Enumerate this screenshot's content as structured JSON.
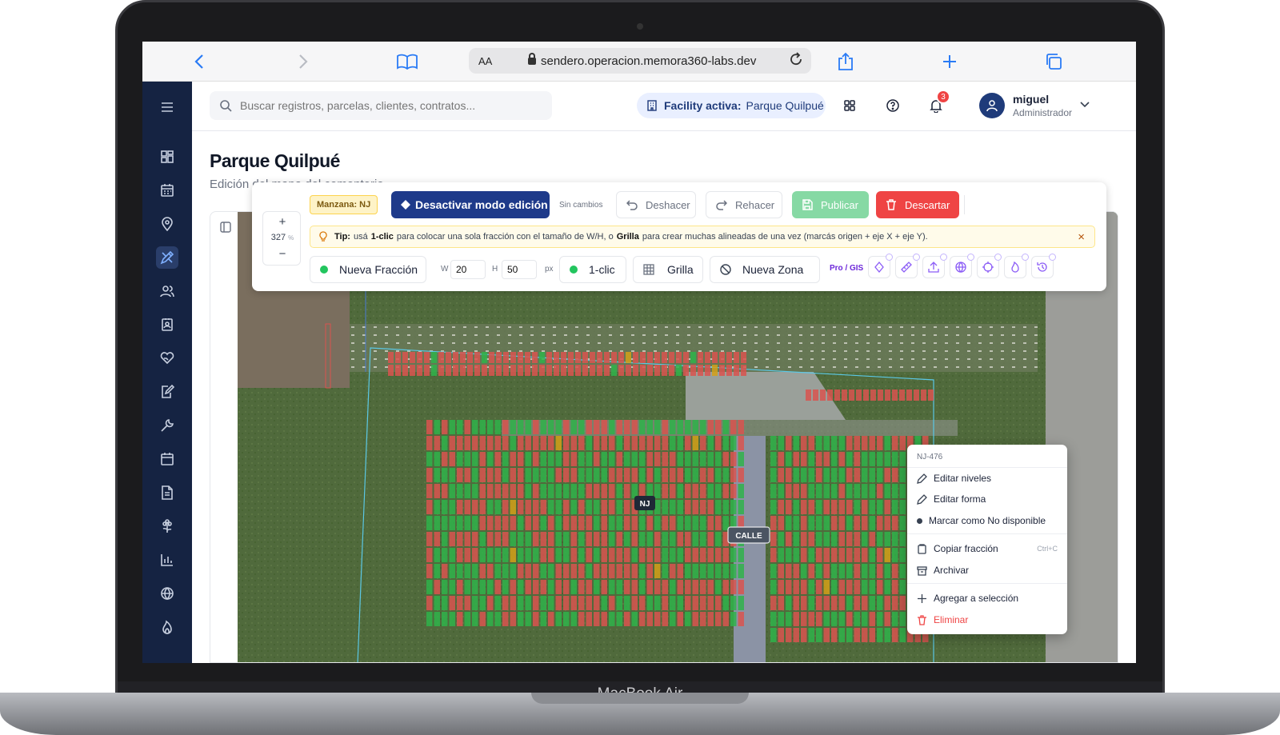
{
  "device": {
    "brand": "MacBook Air"
  },
  "browser": {
    "text_size": "AA",
    "url": "sendero.operacion.memora360-labs.dev",
    "icons": [
      "back-icon",
      "forward-icon",
      "reader-icon",
      "reload-icon",
      "share-icon",
      "new-tab-icon",
      "tabs-icon"
    ]
  },
  "topbar": {
    "search_placeholder": "Buscar registros, parcelas, clientes, contratos...",
    "facility_label": "Facility activa:",
    "facility_value": "Parque Quilpué",
    "notification_count": "3",
    "user_name": "miguel",
    "user_role": "Administrador"
  },
  "sidebar": {
    "icons": [
      "menu-icon",
      "dashboard-icon",
      "calendar-icon",
      "location-pin-icon",
      "map-edit-icon",
      "users-icon",
      "contacts-icon",
      "heart-hand-icon",
      "document-edit-icon",
      "wrench-icon",
      "calendar-alt-icon",
      "file-icon",
      "flower-icon",
      "bar-chart-icon",
      "globe-icon",
      "flame-icon"
    ],
    "active": "map-edit-icon"
  },
  "page": {
    "title": "Parque Quilpué",
    "subtitle": "Edición del mapa del cementerio"
  },
  "toolbar": {
    "zoom_in": "+",
    "zoom_value": "327",
    "zoom_unit": "%",
    "zoom_out": "−",
    "manzana": "Manzana: NJ",
    "edit_mode_button": "Desactivar modo edición",
    "status": "Sin cambios",
    "undo": "Deshacer",
    "redo": "Rehacer",
    "publish": "Publicar",
    "discard": "Descartar",
    "tip": {
      "label": "Tip:",
      "t1": "usá",
      "k1": "1-clic",
      "t2": "para colocar una sola fracción con el tamaño de W/H, o",
      "k2": "Grilla",
      "t3": "para crear muchas alineadas de una vez (marcás origen + eje X + eje Y).",
      "close": "×"
    },
    "new_fraction": "Nueva Fracción",
    "w_label": "W",
    "w_value": "20",
    "h_label": "H",
    "h_value": "50",
    "unit": "px",
    "one_click": "1-clic",
    "grid": "Grilla",
    "new_zone": "Nueva Zona",
    "pro_gis": "Pro / GIS",
    "gis_icons": [
      "pen-tool-icon",
      "ruler-icon",
      "upload-icon",
      "globe-icon",
      "crosshair-icon",
      "flame-icon",
      "history-icon"
    ]
  },
  "map": {
    "block_label": "NJ",
    "street_label": "CALLE",
    "colors": {
      "occupied": "#d9534f",
      "available": "#2fb34a",
      "reserved": "#d4a017",
      "zone_outline": "#5bc8e6"
    }
  },
  "context_menu": {
    "header": "NJ-476",
    "items": {
      "edit_levels": "Editar niveles",
      "edit_shape": "Editar forma",
      "mark_unavailable": "Marcar como No disponible",
      "copy": "Copiar fracción",
      "copy_shortcut": "Ctrl+C",
      "archive": "Archivar",
      "add_selection": "Agregar a selección",
      "delete": "Eliminar"
    }
  }
}
